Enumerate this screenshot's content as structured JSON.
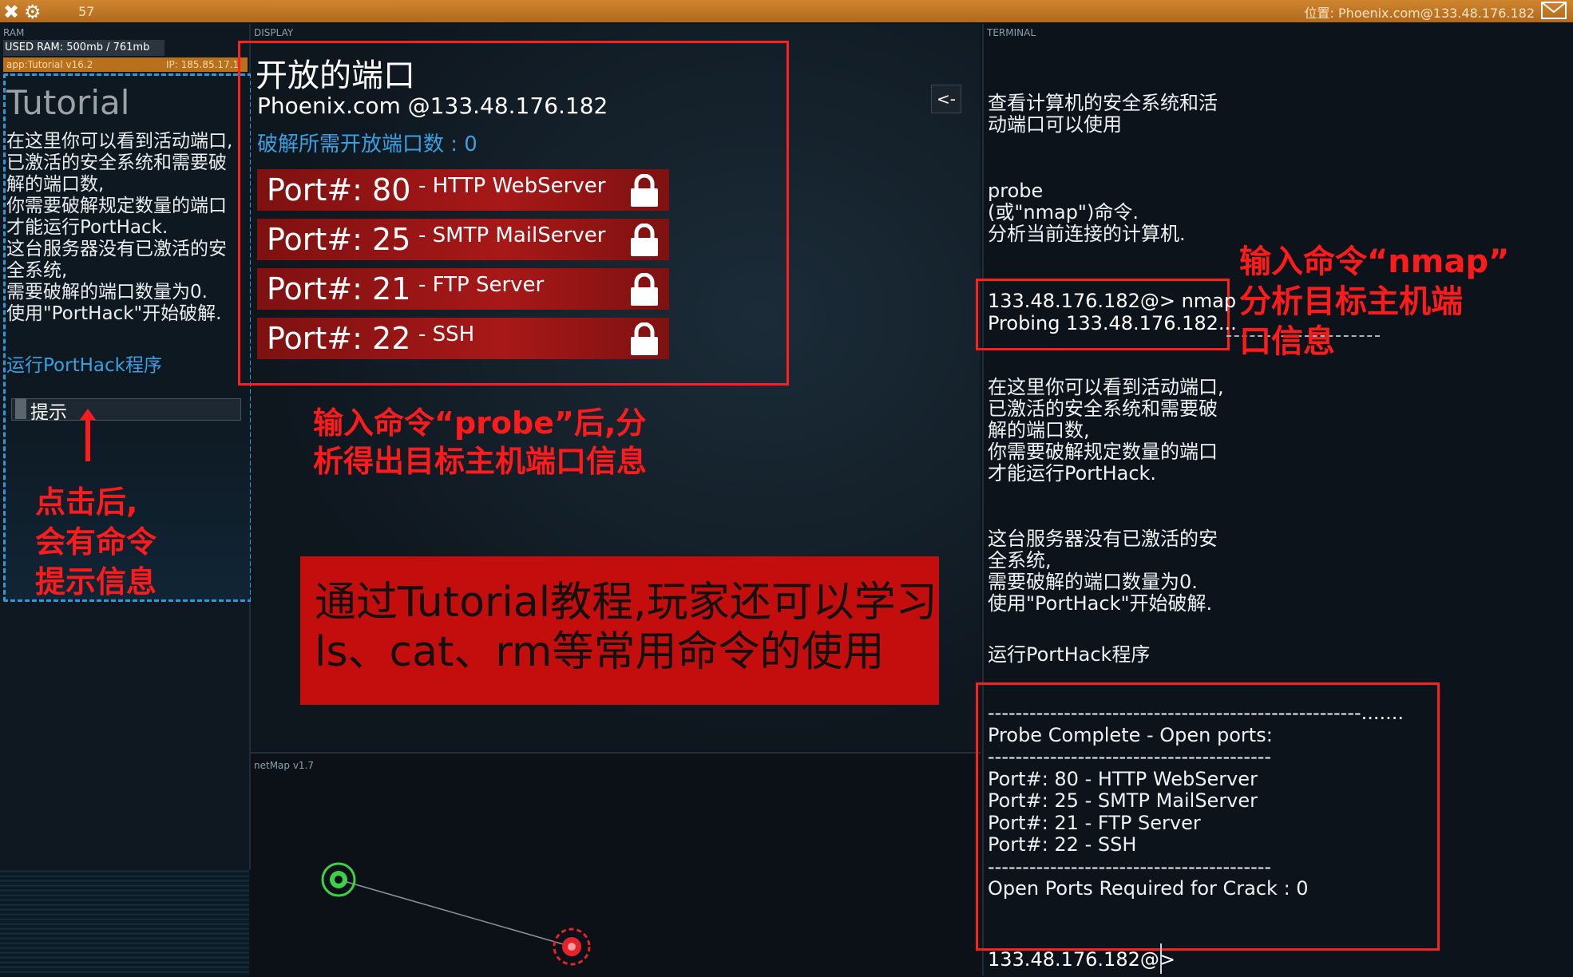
{
  "topbar": {
    "count": "57",
    "location": "位置: Phoenix.com@133.48.176.182"
  },
  "ram": {
    "label": "RAM",
    "usage": "USED RAM: 500mb / 761mb",
    "app_name": "app:Tutorial v16.2",
    "app_ip": "IP: 185.85.17.1"
  },
  "tutorial": {
    "title": "Tutorial",
    "body": "在这里你可以看到活动端口,\n已激活的安全系统和需要破\n解的端口数,\n你需要破解规定数量的端口\n才能运行PortHack.\n这台服务器没有已激活的安\n全系统,\n需要破解的端口数量为0.\n使用\"PortHack\"开始破解.",
    "link": "运行PortHack程序",
    "hint": "提示",
    "annotation": "点击后,\n会有命令\n提示信息"
  },
  "display": {
    "label": "DISPLAY",
    "title": "开放的端口",
    "host": "Phoenix.com @133.48.176.182",
    "required": "破解所需开放端口数 :  0",
    "ports": [
      {
        "num": "Port#: 80",
        "service": "- HTTP WebServer"
      },
      {
        "num": "Port#: 25",
        "service": "- SMTP MailServer"
      },
      {
        "num": "Port#: 21",
        "service": "- FTP Server"
      },
      {
        "num": "Port#: 22",
        "service": "- SSH"
      }
    ],
    "back": "<-",
    "probe_annotation": "输入命令“probe”后,分\n析得出目标主机端口信息",
    "banner": "通过Tutorial教程,玩家还可以学习ls、cat、rm等常用命令的使用"
  },
  "netmap": {
    "label": "netMap v1.7"
  },
  "terminal": {
    "label": "TERMINAL",
    "intro": "查看计算机的安全系统和活\n动端口可以使用",
    "probe_help": "probe\n(或\"nmap\")命令.\n分析当前连接的计算机.",
    "cmd": "133.48.176.182@> nmap\nProbing 133.48.176.182...",
    "nmap_annotation": "输入命令“nmap”\n分析目标主机端\n口信息",
    "ports_info": "在这里你可以看到活动端口,\n已激活的安全系统和需要破\n解的端口数,\n你需要破解规定数量的端口\n才能运行PortHack.",
    "security_info": "这台服务器没有已激活的安\n全系统,\n需要破解的端口数量为0.\n使用\"PortHack\"开始破解.",
    "run_link": "运行PortHack程序",
    "result": "------------------------------------------------------.......\nProbe Complete - Open ports:\n-----------------------------------------\nPort#: 80  -  HTTP WebServer\nPort#: 25  -  SMTP MailServer\nPort#: 21  -  FTP Server\nPort#: 22  -  SSH\n-----------------------------------------\nOpen Ports Required for Crack : 0",
    "prompt": "133.48.176.182@>"
  }
}
